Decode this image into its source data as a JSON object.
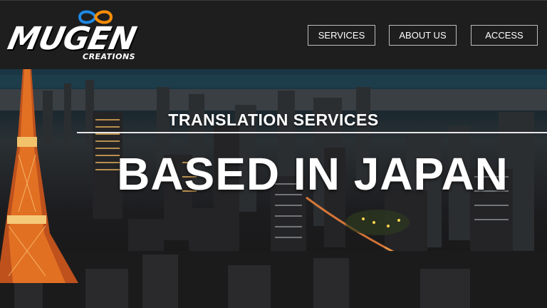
{
  "brand": {
    "name": "MUGEN",
    "subtitle": "CREATIONS",
    "logo_icon": "infinity-icon",
    "accent_colors": [
      "#1e88e5",
      "#ff8c00"
    ]
  },
  "nav": {
    "items": [
      {
        "label": "SERVICES"
      },
      {
        "label": "ABOUT US"
      },
      {
        "label": "ACCESS"
      }
    ]
  },
  "hero": {
    "subtitle": "TRANSLATION SERVICES",
    "title": "BASED IN JAPAN",
    "background": "tokyo-night-cityscape"
  }
}
